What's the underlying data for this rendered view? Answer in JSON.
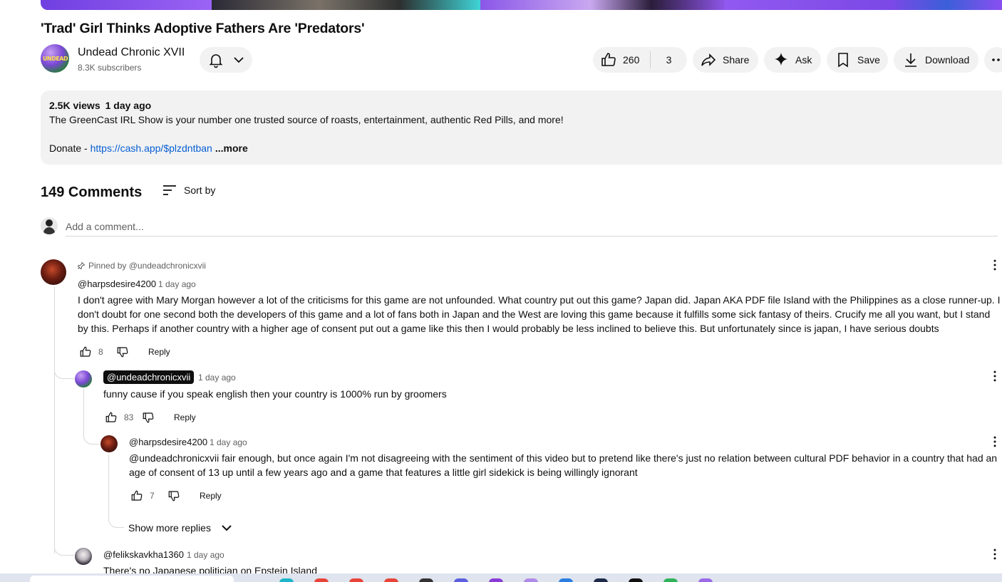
{
  "video": {
    "title": "'Trad' Girl Thinks Adoptive Fathers Are 'Predators'"
  },
  "channel": {
    "name": "Undead Chronic XVII",
    "subscribers": "8.3K subscribers",
    "avatar_text": "UNDEAD"
  },
  "actions": {
    "likes": "260",
    "dislikes": "3",
    "share": "Share",
    "ask": "Ask",
    "save": "Save",
    "download": "Download"
  },
  "description": {
    "views": "2.5K views",
    "age": "1 day ago",
    "line1": "The GreenCast IRL Show is your number one trusted source of roasts, entertainment, authentic Red Pills, and more!",
    "donate_label": "Donate - ",
    "donate_link": "https://cash.app/$plzdntban",
    "more": "...more"
  },
  "comments_header": {
    "count": "149 Comments",
    "sort_label": "Sort by"
  },
  "add_comment": {
    "placeholder": "Add a comment..."
  },
  "comments": [
    {
      "pinned": "Pinned by @undeadchronicxvii",
      "author": "@harpsdesire4200",
      "time": "1 day ago",
      "text": "I don't agree with Mary Morgan however a lot of the criticisms for this game are not unfounded. What country put out this game? Japan did. Japan AKA PDF file Island with the Philippines as a close runner-up. I don't doubt for one second both the developers of this game and a lot of fans both in Japan and the West are loving this game because it fulfills some sick fantasy of theirs. Crucify me all you want, but I stand by this. Perhaps if another country with a higher age of consent put out a game like this then I would probably be less inclined to believe this. But unfortunately since is japan, I have serious doubts",
      "likes": "8",
      "reply": "Reply"
    },
    {
      "author": "@undeadchronicxvii",
      "time": "1 day ago",
      "text": "funny cause if you speak english then your country is 1000% run by groomers",
      "likes": "83",
      "reply": "Reply"
    },
    {
      "author": "@harpsdesire4200",
      "time": "1 day ago",
      "text": "@undeadchronicxvii fair enough, but once again I'm not disagreeing with the sentiment of this video but to pretend like there's just no relation between cultural PDF behavior in a country that had an age of consent of 13 up until a few years ago and a game that features a little girl sidekick is being willingly ignorant",
      "likes": "7",
      "reply": "Reply"
    },
    {
      "author": "@felikskavkha1360",
      "time": "1 day ago",
      "text": "There's no Japanese politician on Epstein Island"
    }
  ],
  "show_more_replies": "Show more replies",
  "taskbar_colors": [
    "#1fb5c9",
    "#e8443a",
    "#e8443a",
    "#e8443a",
    "#333333",
    "#5b5fe0",
    "#8a3ad6",
    "#b08ae8",
    "#2a7de1",
    "#1e2a4a",
    "#111111",
    "#2fb35a",
    "#9b6ae8"
  ]
}
